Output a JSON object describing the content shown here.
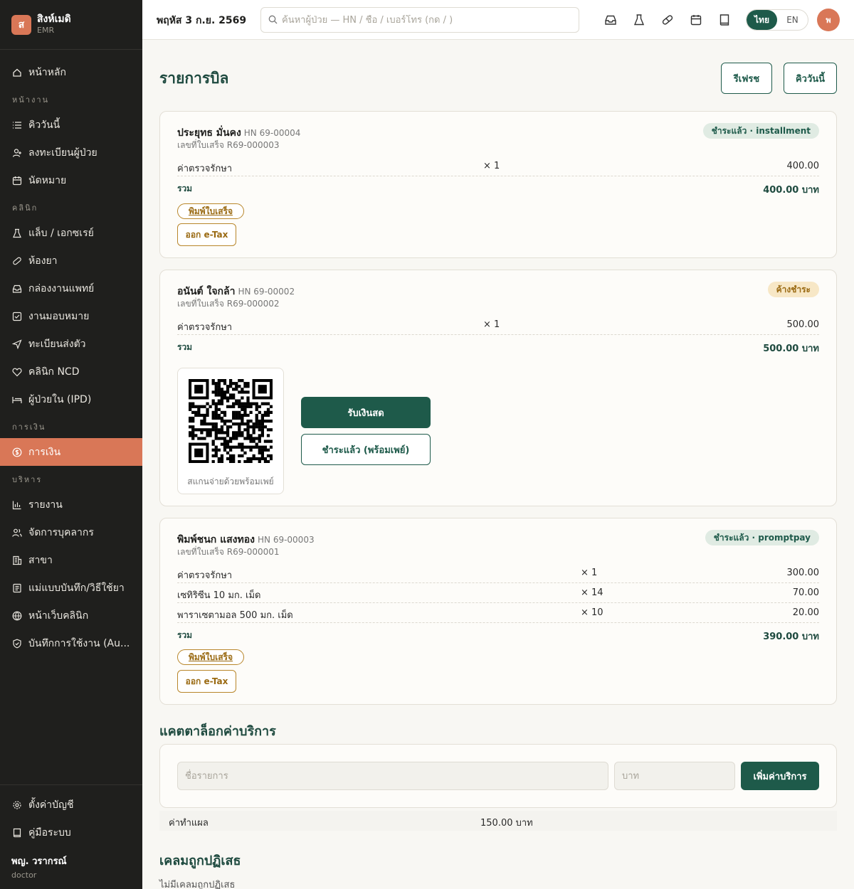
{
  "app": {
    "logo_letter": "ส",
    "name": "สิงห์เมดิ",
    "sub": "EMR"
  },
  "sidebar": {
    "home": "หน้าหลัก",
    "sections": {
      "work": "หน้างาน",
      "clinic": "คลินิก",
      "finance": "การเงิน",
      "admin": "บริหาร"
    },
    "work_items": [
      "คิววันนี้",
      "ลงทะเบียนผู้ป่วย",
      "นัดหมาย"
    ],
    "clinic_items": [
      "แล็บ / เอกซเรย์",
      "ห้องยา",
      "กล่องงานแพทย์",
      "งานมอบหมาย",
      "ทะเบียนส่งตัว",
      "คลินิก NCD",
      "ผู้ป่วยใน (IPD)"
    ],
    "finance_items": [
      "การเงิน"
    ],
    "admin_items": [
      "รายงาน",
      "จัดการบุคลากร",
      "สาขา",
      "แม่แบบบันทึก/วิธีใช้ยา",
      "หน้าเว็บคลินิก",
      "บันทึกการใช้งาน (Au..."
    ],
    "footer_items": [
      "ตั้งค่าบัญชี",
      "คู่มือระบบ"
    ],
    "user": {
      "name": "พญ. วรากรณ์",
      "role": "doctor"
    }
  },
  "topbar": {
    "date": "พฤหัส 3 ก.ย. 2569",
    "search_placeholder": "ค้นหาผู้ป่วย — HN / ชื่อ / เบอร์โทร (กด / )",
    "lang_th": "ไทย",
    "lang_en": "EN",
    "avatar_letter": "พ"
  },
  "main": {
    "title": "รายการบิล",
    "refresh_label": "รีเฟรช",
    "queue_label": "คิววันนี้",
    "total_label": "รวม",
    "print_label": "พิมพ์ใบเสร็จ",
    "etax_label": "ออก e-Tax",
    "bills": [
      {
        "name": "ประยุทธ มั่นคง",
        "hn": "HN 69-00004",
        "receipt": "เลขที่ใบเสร็จ R69-000003",
        "status": "ชำระแล้ว · installment",
        "items": [
          {
            "desc": "ค่าตรวจรักษา",
            "qty": "× 1",
            "amount": "400.00"
          }
        ],
        "total": "400.00 บาท"
      },
      {
        "name": "อนันต์ ใจกล้า",
        "hn": "HN 69-00002",
        "receipt": "เลขที่ใบเสร็จ R69-000002",
        "status": "ค้างชำระ",
        "items": [
          {
            "desc": "ค่าตรวจรักษา",
            "qty": "× 1",
            "amount": "500.00"
          }
        ],
        "total": "500.00 บาท",
        "qr_caption": "สแกนจ่ายด้วยพร้อมเพย์",
        "cash_label": "รับเงินสด",
        "promptpay_label": "ชำระแล้ว (พร้อมเพย์)"
      },
      {
        "name": "พิมพ์ชนก แสงทอง",
        "hn": "HN 69-00003",
        "receipt": "เลขที่ใบเสร็จ R69-000001",
        "status": "ชำระแล้ว · promptpay",
        "items": [
          {
            "desc": "ค่าตรวจรักษา",
            "qty": "× 1",
            "amount": "300.00"
          },
          {
            "desc": "เซทิริซีน 10 มก. เม็ด",
            "qty": "× 14",
            "amount": "70.00"
          },
          {
            "desc": "พาราเซตามอล 500 มก. เม็ด",
            "qty": "× 10",
            "amount": "20.00"
          }
        ],
        "total": "390.00 บาท"
      }
    ],
    "catalog": {
      "title": "แคตตาล็อกค่าบริการ",
      "name_placeholder": "ชื่อรายการ",
      "price_placeholder": "บาท",
      "add_label": "เพิ่มค่าบริการ",
      "items": [
        {
          "name": "ค่าทำแผล",
          "price": "150.00 บาท"
        }
      ]
    },
    "rejected": {
      "title": "เคลมถูกปฏิเสธ",
      "empty": "ไม่มีเคลมถูกปฏิเสธ"
    }
  },
  "colors": {
    "accent": "#d97757",
    "primary": "#1e5a4a",
    "sidebar_bg": "#1f1f1d",
    "pending": "#9a6a12"
  }
}
